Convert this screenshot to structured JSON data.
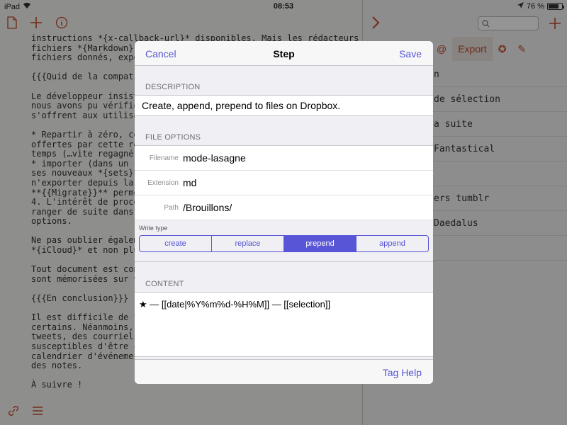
{
  "status": {
    "device": "iPad",
    "time": "08:53",
    "battery": "76 %",
    "battery_level": 0.76
  },
  "editor": {
    "toolbar": {
      "doc_icon": "document-icon",
      "plus_icon": "plus-icon",
      "info_icon": "info-icon"
    },
    "lines": [
      "instructions *{x-callback-url}* disponibles. Mais les rédacteurs ai",
      "fichiers *{Markdown}* ",
      "fichiers donnés, expo",
      "",
      "{{{Quid de la compati",
      "",
      "Le développeur insist",
      "nous avons pu vérifie",
      "s'offrent aux utilisa",
      "",
      "* Repartir à zéro, ce",
      "offertes par cette ré",
      "temps (…vite regagné ",
      "* importer (dans un s",
      "ses nouveaux *{sets}*",
      "n'exporter depuis la ",
      "**{{Migrate}}** perme",
      "4. L'intérêt de procé",
      "ranger de suite dans ",
      "options.",
      "",
      "Ne pas oublier égalem",
      "*{iCloud}* et non plu",
      "",
      "Tout document est con",
      "sont mémorisées sur v",
      "",
      "{{{En conclusion}}}",
      "",
      "Il est difficile de f",
      "certains. Néanmoins, ",
      "tweets, des courriels",
      "susceptibles d'être c",
      "calendrier d'événemer",
      "des notes.",
      "",
      "À suivre !"
    ]
  },
  "right_panel": {
    "search_placeholder": "",
    "tabs": [
      {
        "label": "@",
        "active": false
      },
      {
        "label": "Export",
        "active": true
      },
      {
        "label": "✪",
        "active": false
      },
      {
        "label": "✎",
        "active": false
      }
    ],
    "items": [
      "n",
      "de sélection",
      "a suite",
      " Fantastical",
      "",
      "ers tumblr",
      "Daedalus",
      ""
    ]
  },
  "modal": {
    "cancel": "Cancel",
    "title": "Step",
    "save": "Save",
    "description_header": "DESCRIPTION",
    "description": "Create, append, prepend to files on Dropbox.",
    "file_options_header": "FILE OPTIONS",
    "fields": [
      {
        "label": "Filename",
        "value": "mode-lasagne"
      },
      {
        "label": "Extension",
        "value": "md"
      },
      {
        "label": "Path",
        "value": "/Brouillons/"
      }
    ],
    "write_type_label": "Write type",
    "write_types": [
      {
        "label": "create",
        "selected": false
      },
      {
        "label": "replace",
        "selected": false
      },
      {
        "label": "prepend",
        "selected": true
      },
      {
        "label": "append",
        "selected": false
      }
    ],
    "content_header": "CONTENT",
    "content": "★ — [[date|%Y%m%d-%H%M]] — [[selection]]",
    "tag_help": "Tag Help"
  },
  "colors": {
    "accent": "#5856d6",
    "app_red": "#c44a2a"
  }
}
